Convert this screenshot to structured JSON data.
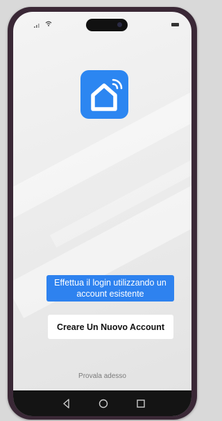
{
  "status_bar": {
    "signal_icon": "signal-icon",
    "wifi_icon": "wifi-icon",
    "battery_icon": "battery-icon"
  },
  "app": {
    "logo_icon": "smart-home-icon",
    "logo_color": "#2c86f1"
  },
  "login": {
    "label": "Effettua il login utilizzando un account esistente",
    "background": "#2e82ef"
  },
  "create_account": {
    "label": "Creare Un Nuovo Account"
  },
  "try_now": {
    "label": "Provala adesso"
  },
  "nav_bar": {
    "items": [
      "back-icon",
      "home-icon",
      "recents-icon"
    ]
  }
}
